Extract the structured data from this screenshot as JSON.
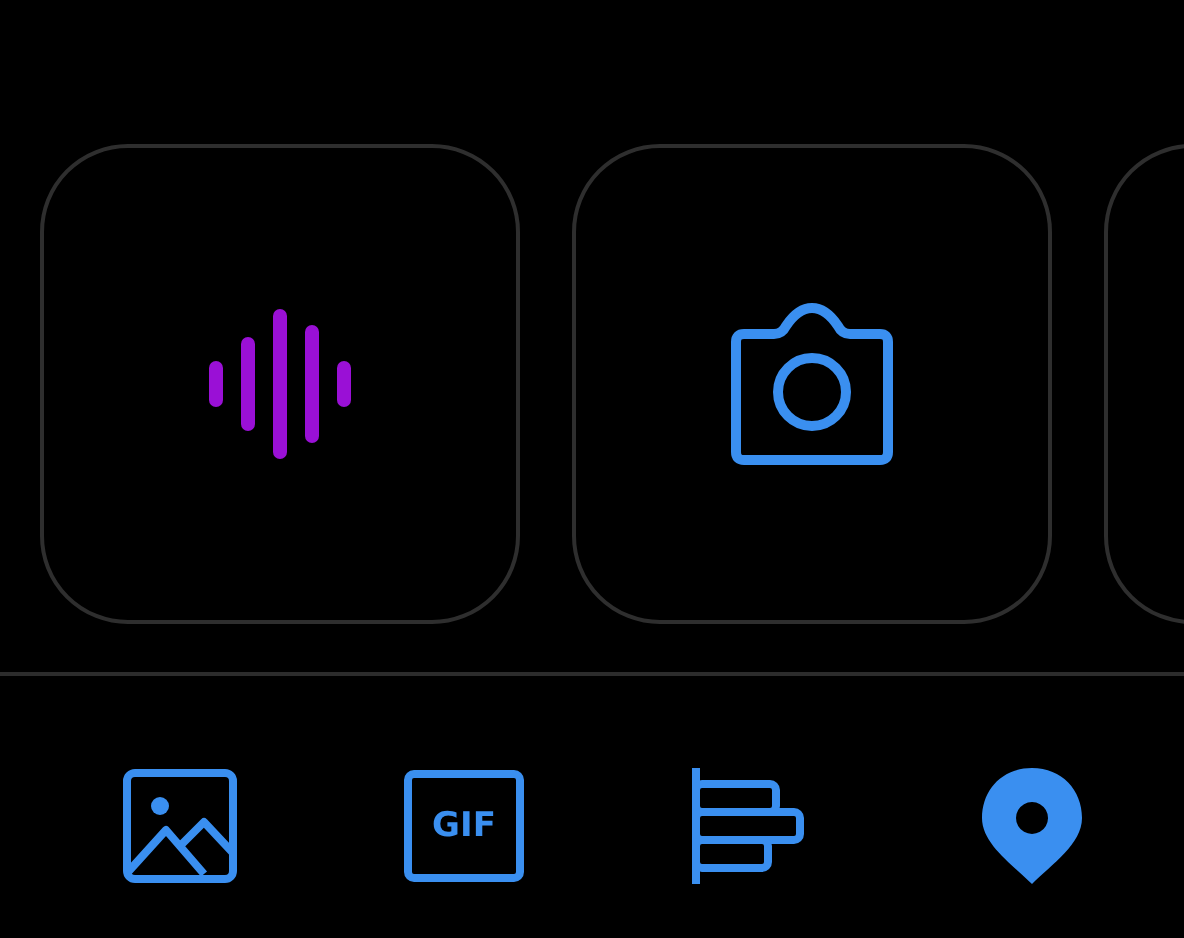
{
  "attachment_cards": [
    {
      "kind": "voice"
    },
    {
      "kind": "camera"
    },
    {
      "kind": "blank"
    }
  ],
  "toolbar": [
    {
      "kind": "image"
    },
    {
      "kind": "gif",
      "label": "GIF"
    },
    {
      "kind": "poll"
    },
    {
      "kind": "location"
    }
  ]
}
